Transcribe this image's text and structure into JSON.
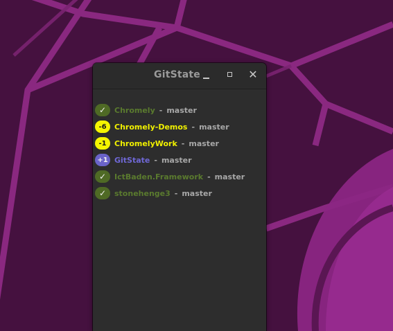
{
  "window": {
    "title": "GitState",
    "controls": {
      "minimize": "minimize-icon",
      "maximize": "maximize-icon",
      "close": "close-icon"
    }
  },
  "repositories": [
    {
      "status": "clean",
      "badge": "✓",
      "name": "Chromely",
      "separator": "-",
      "branch": "master"
    },
    {
      "status": "behind",
      "badge": "-6",
      "name": "Chromely-Demos",
      "separator": "-",
      "branch": "master"
    },
    {
      "status": "behind",
      "badge": "-1",
      "name": "ChromelyWork",
      "separator": "-",
      "branch": "master"
    },
    {
      "status": "ahead",
      "badge": "+1",
      "name": "GitState",
      "separator": "-",
      "branch": "master"
    },
    {
      "status": "clean",
      "badge": "✓",
      "name": "IctBaden.Framework",
      "separator": "-",
      "branch": "master"
    },
    {
      "status": "clean",
      "badge": "✓",
      "name": "stonehenge3",
      "separator": "-",
      "branch": "master"
    }
  ],
  "colors": {
    "clean_badge": "#4f6a25",
    "clean_text": "#5a7a2e",
    "behind_badge": "#f5f500",
    "behind_text": "#f0f000",
    "ahead_badge": "#6a63c9",
    "ahead_text": "#6f68d6",
    "window_bg": "#2d2d2d",
    "desktop_bg": "#44113d"
  }
}
